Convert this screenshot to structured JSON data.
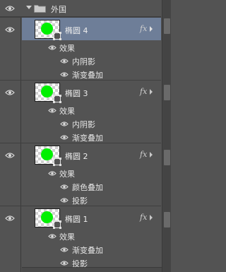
{
  "group": {
    "label": "外国"
  },
  "layers": [
    {
      "name": "椭圆 4",
      "selected": true,
      "effects_label": "效果",
      "effects": [
        "内阴影",
        "渐变叠加"
      ]
    },
    {
      "name": "椭圆 3",
      "selected": false,
      "effects_label": "效果",
      "effects": [
        "内阴影",
        "渐变叠加"
      ]
    },
    {
      "name": "椭圆 2",
      "selected": false,
      "effects_label": "效果",
      "effects": [
        "颜色叠加",
        "投影"
      ]
    },
    {
      "name": "椭圆 1",
      "selected": false,
      "effects_label": "效果",
      "effects": [
        "渐变叠加",
        "投影"
      ]
    }
  ],
  "fx_label": "fx",
  "colors": {
    "panel_bg": "#535353",
    "selected_bg": "#6e7e98",
    "shape_fill": "#00f000"
  },
  "icons": [
    "eye-icon",
    "folder-icon",
    "disclosure-triangle-icon",
    "fx-icon",
    "shape-layer-icon"
  ]
}
